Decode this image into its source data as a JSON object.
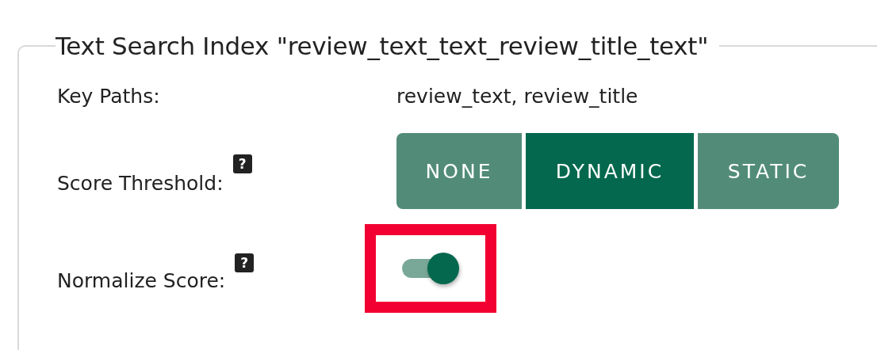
{
  "panel": {
    "title": "Text Search Index \"review_text_text_review_title_text\""
  },
  "rows": [
    {
      "kind": "text",
      "label": "Key Paths:",
      "value": "review_text, review_title"
    },
    {
      "kind": "segmented",
      "label": "Score Threshold:",
      "help": "?",
      "options": [
        {
          "label": "NONE",
          "selected": false
        },
        {
          "label": "DYNAMIC",
          "selected": true
        },
        {
          "label": "STATIC",
          "selected": false
        }
      ]
    },
    {
      "kind": "toggle",
      "label": "Normalize Score:",
      "help": "?",
      "on": true,
      "highlighted": true
    }
  ]
}
